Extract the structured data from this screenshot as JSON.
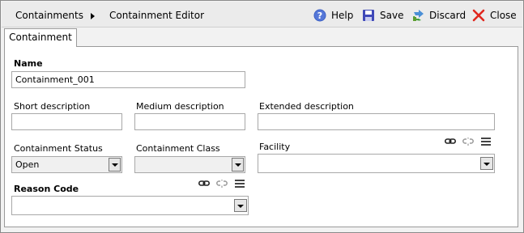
{
  "breadcrumb": {
    "root": "Containments",
    "current": "Containment Editor"
  },
  "toolbar": {
    "help": "Help",
    "save": "Save",
    "discard": "Discard",
    "close": "Close"
  },
  "tabs": [
    {
      "label": "Containment",
      "active": true
    }
  ],
  "form": {
    "name": {
      "label": "Name",
      "value": "Containment_001"
    },
    "short_description": {
      "label": "Short description",
      "value": ""
    },
    "medium_description": {
      "label": "Medium description",
      "value": ""
    },
    "extended_description": {
      "label": "Extended description",
      "value": ""
    },
    "containment_status": {
      "label": "Containment Status",
      "value": "Open"
    },
    "containment_class": {
      "label": "Containment Class",
      "value": ""
    },
    "facility": {
      "label": "Facility",
      "value": ""
    },
    "reason_code": {
      "label": "Reason Code",
      "value": ""
    }
  },
  "icons": {
    "help": "help-circle-icon",
    "save": "floppy-disk-icon",
    "discard": "discard-icon",
    "close": "close-x-icon",
    "link": "link-icon",
    "unlink": "unlink-icon",
    "menu": "list-menu-icon"
  },
  "colors": {
    "help_icon": "#3b5fc4",
    "save_icon": "#3f48b8",
    "close_icon": "#e0271e",
    "discard_icon": "#3a9a35"
  }
}
